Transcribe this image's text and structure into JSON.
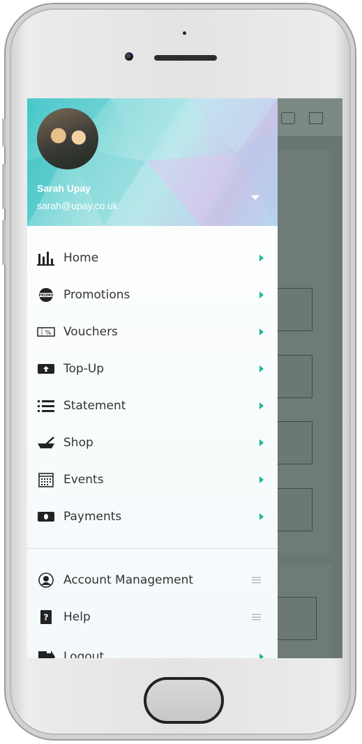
{
  "user": {
    "name": "Sarah Upay",
    "email": "sarah@upay.co.uk"
  },
  "menu": [
    {
      "label": "Home",
      "icon": "bar-chart-icon"
    },
    {
      "label": "Promotions",
      "icon": "promo-icon"
    },
    {
      "label": "Vouchers",
      "icon": "voucher-icon"
    },
    {
      "label": "Top-Up",
      "icon": "top-up-icon"
    },
    {
      "label": "Statement",
      "icon": "list-icon"
    },
    {
      "label": "Shop",
      "icon": "shop-icon"
    },
    {
      "label": "Events",
      "icon": "calendar-icon"
    },
    {
      "label": "Payments",
      "icon": "payment-icon"
    }
  ],
  "secondary_menu": [
    {
      "label": "Account Management",
      "icon": "account-icon"
    },
    {
      "label": "Help",
      "icon": "help-icon"
    },
    {
      "label": "Logout",
      "icon": "logout-icon"
    }
  ],
  "icon_text": {
    "promo": "PROMO",
    "voucher": "%",
    "help": "?"
  },
  "colors": {
    "accent_arrow": "#1db98f",
    "header_teal": "#3fc6c8",
    "header_lavender": "#c9c3e6"
  }
}
